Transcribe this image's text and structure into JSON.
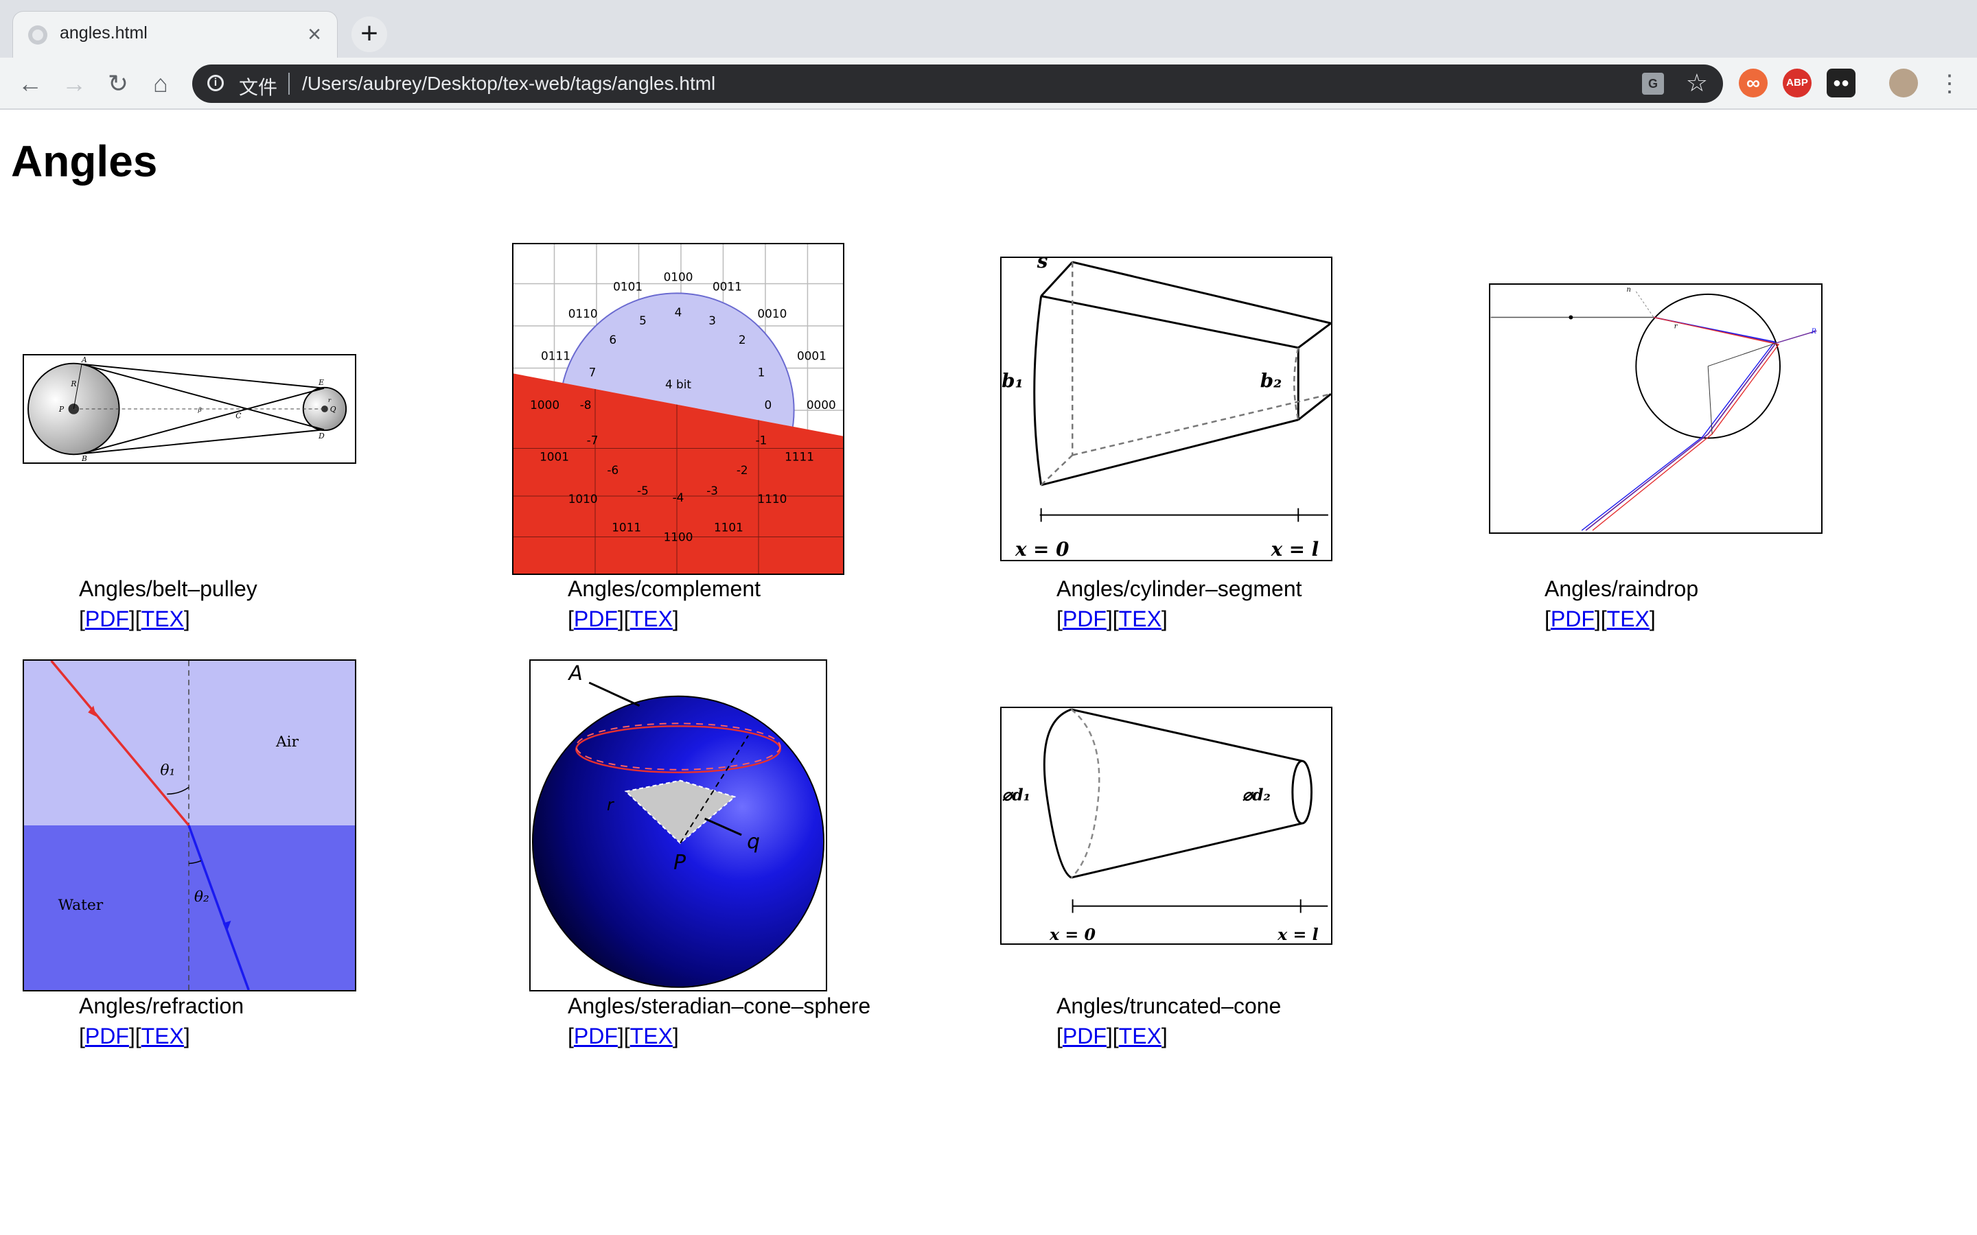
{
  "browser": {
    "tab_title": "angles.html",
    "tab_close": "×",
    "new_tab": "+",
    "scheme_label": "文件",
    "url": "/Users/aubrey/Desktop/tex-web/tags/angles.html"
  },
  "page": {
    "title": "Angles",
    "items": [
      {
        "name": "Angles/belt–pulley",
        "pdf": "PDF",
        "tex": "TEX"
      },
      {
        "name": "Angles/complement",
        "pdf": "PDF",
        "tex": "TEX"
      },
      {
        "name": "Angles/cylinder–segment",
        "pdf": "PDF",
        "tex": "TEX"
      },
      {
        "name": "Angles/raindrop",
        "pdf": "PDF",
        "tex": "TEX"
      },
      {
        "name": "Angles/refraction",
        "pdf": "PDF",
        "tex": "TEX"
      },
      {
        "name": "Angles/steradian–cone–sphere",
        "pdf": "PDF",
        "tex": "TEX"
      },
      {
        "name": "Angles/truncated–cone",
        "pdf": "PDF",
        "tex": "TEX"
      }
    ]
  },
  "figures": {
    "belt_pulley": {
      "labels": [
        "A",
        "B",
        "C",
        "D",
        "E",
        "P",
        "Q",
        "R",
        "r",
        "β"
      ]
    },
    "complement": {
      "center_label": "4 bit",
      "positive_values": [
        "0",
        "1",
        "2",
        "3",
        "4",
        "5",
        "6",
        "7"
      ],
      "negative_values": [
        "-1",
        "-2",
        "-3",
        "-4",
        "-5",
        "-6",
        "-7",
        "-8"
      ],
      "codes": [
        "0000",
        "0001",
        "0010",
        "0011",
        "0100",
        "0101",
        "0110",
        "0111",
        "1000",
        "1001",
        "1010",
        "1011",
        "1100",
        "1101",
        "1110",
        "1111"
      ]
    },
    "cylinder_segment": {
      "labels": [
        "s",
        "b₁",
        "b₂",
        "x = 0",
        "x = l"
      ]
    },
    "raindrop": {
      "labels": [
        "n",
        "r",
        "R"
      ]
    },
    "refraction": {
      "labels": [
        "Air",
        "Water",
        "θ₁",
        "θ₂"
      ],
      "colors": {
        "air": "#bfbff7",
        "water": "#6666f0",
        "ray_in": "#e53030",
        "ray_out": "#1a1af0"
      }
    },
    "steradian": {
      "labels": [
        "A",
        "r",
        "P",
        "q"
      ]
    },
    "truncated_cone": {
      "labels": [
        "⌀d₁",
        "⌀d₂",
        "x = 0",
        "x = l"
      ]
    }
  }
}
